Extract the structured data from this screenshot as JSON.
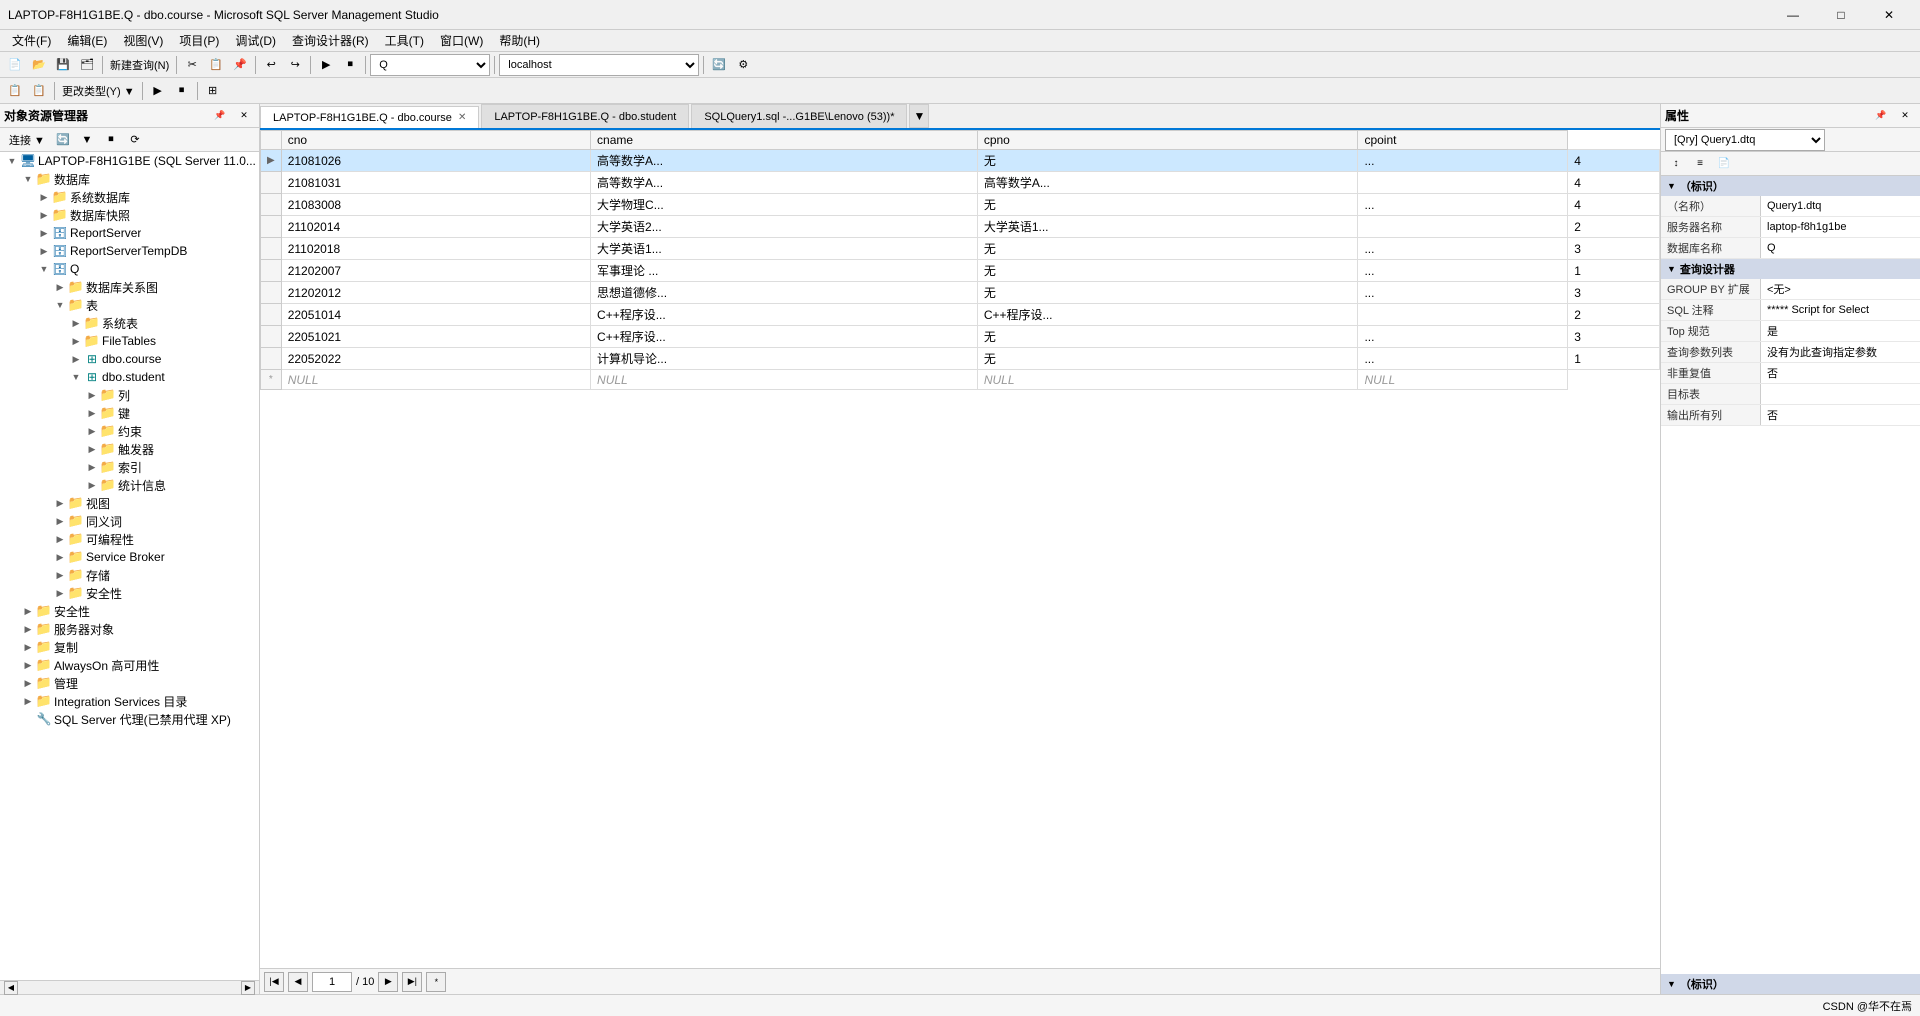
{
  "titlebar": {
    "title": "LAPTOP-F8H1G1BE.Q - dbo.course - Microsoft SQL Server Management Studio",
    "minimize": "—",
    "maximize": "□",
    "close": "✕"
  },
  "menubar": {
    "items": [
      "文件(F)",
      "编辑(E)",
      "视图(V)",
      "项目(P)",
      "调试(D)",
      "查询设计器(R)",
      "工具(T)",
      "窗口(W)",
      "帮助(H)"
    ]
  },
  "left_panel": {
    "title": "对象资源管理器",
    "connect_label": "连接 ▼",
    "tree": [
      {
        "id": "server",
        "level": 0,
        "label": "LAPTOP-F8H1G1BE (SQL Server 11.0...",
        "icon": "server",
        "expanded": true
      },
      {
        "id": "databases",
        "level": 1,
        "label": "数据库",
        "icon": "folder",
        "expanded": true
      },
      {
        "id": "sysdbs",
        "level": 2,
        "label": "系统数据库",
        "icon": "folder",
        "expanded": false
      },
      {
        "id": "dbsnapshots",
        "level": 2,
        "label": "数据库快照",
        "icon": "folder",
        "expanded": false
      },
      {
        "id": "reportserver",
        "level": 2,
        "label": "ReportServer",
        "icon": "db",
        "expanded": false
      },
      {
        "id": "reportservertempdb",
        "level": 2,
        "label": "ReportServerTempDB",
        "icon": "db",
        "expanded": false
      },
      {
        "id": "Q",
        "level": 2,
        "label": "Q",
        "icon": "db",
        "expanded": true
      },
      {
        "id": "dbdiagram",
        "level": 3,
        "label": "数据库关系图",
        "icon": "folder",
        "expanded": false
      },
      {
        "id": "tables",
        "level": 3,
        "label": "表",
        "icon": "folder",
        "expanded": true
      },
      {
        "id": "systables",
        "level": 4,
        "label": "系统表",
        "icon": "folder",
        "expanded": false
      },
      {
        "id": "filetables",
        "level": 4,
        "label": "FileTables",
        "icon": "folder",
        "expanded": false
      },
      {
        "id": "dbo_course",
        "level": 4,
        "label": "dbo.course",
        "icon": "table",
        "expanded": false
      },
      {
        "id": "dbo_student",
        "level": 4,
        "label": "dbo.student",
        "icon": "table",
        "expanded": true
      },
      {
        "id": "col",
        "level": 5,
        "label": "列",
        "icon": "folder",
        "expanded": false
      },
      {
        "id": "key",
        "level": 5,
        "label": "键",
        "icon": "folder",
        "expanded": false
      },
      {
        "id": "constraint",
        "level": 5,
        "label": "约束",
        "icon": "folder",
        "expanded": false
      },
      {
        "id": "trigger",
        "level": 5,
        "label": "触发器",
        "icon": "folder",
        "expanded": false
      },
      {
        "id": "index",
        "level": 5,
        "label": "索引",
        "icon": "folder",
        "expanded": false
      },
      {
        "id": "stats",
        "level": 5,
        "label": "统计信息",
        "icon": "folder",
        "expanded": false
      },
      {
        "id": "views",
        "level": 3,
        "label": "视图",
        "icon": "folder",
        "expanded": false
      },
      {
        "id": "synonyms",
        "level": 3,
        "label": "同义词",
        "icon": "folder",
        "expanded": false
      },
      {
        "id": "programmability",
        "level": 3,
        "label": "可编程性",
        "icon": "folder",
        "expanded": false
      },
      {
        "id": "servicebroker",
        "level": 3,
        "label": "Service Broker",
        "icon": "folder",
        "expanded": false
      },
      {
        "id": "storage",
        "level": 3,
        "label": "存储",
        "icon": "folder",
        "expanded": false
      },
      {
        "id": "security_q",
        "level": 3,
        "label": "安全性",
        "icon": "folder",
        "expanded": false
      },
      {
        "id": "security",
        "level": 1,
        "label": "安全性",
        "icon": "folder",
        "expanded": false
      },
      {
        "id": "serverobjects",
        "level": 1,
        "label": "服务器对象",
        "icon": "folder",
        "expanded": false
      },
      {
        "id": "replication",
        "level": 1,
        "label": "复制",
        "icon": "folder",
        "expanded": false
      },
      {
        "id": "alwayson",
        "level": 1,
        "label": "AlwaysOn 高可用性",
        "icon": "folder",
        "expanded": false
      },
      {
        "id": "management",
        "level": 1,
        "label": "管理",
        "icon": "folder",
        "expanded": false
      },
      {
        "id": "integration",
        "level": 1,
        "label": "Integration Services 目录",
        "icon": "folder",
        "expanded": false
      },
      {
        "id": "sqlagent",
        "level": 1,
        "label": "SQL Server 代理(已禁用代理 XP)",
        "icon": "agent",
        "expanded": false
      }
    ]
  },
  "tabs": [
    {
      "id": "course",
      "label": "LAPTOP-F8H1G1BE.Q - dbo.course",
      "active": true,
      "closeable": true
    },
    {
      "id": "student",
      "label": "LAPTOP-F8H1G1BE.Q - dbo.student",
      "active": false,
      "closeable": false
    },
    {
      "id": "sqlquery",
      "label": "SQLQuery1.sql -...G1BE\\Lenovo (53))*",
      "active": false,
      "closeable": false
    }
  ],
  "grid": {
    "columns": [
      "cno",
      "cname",
      "cpno",
      "cpoint"
    ],
    "rows": [
      {
        "marker": "▶",
        "selected": true,
        "cno": "21081026",
        "cname": "高等数学A...",
        "cpno": "无",
        "cpno2": "...",
        "cpoint": "4"
      },
      {
        "marker": "",
        "selected": false,
        "cno": "21081031",
        "cname": "高等数学A...",
        "cpno": "高等数学A...",
        "cpno2": "",
        "cpoint": "4"
      },
      {
        "marker": "",
        "selected": false,
        "cno": "21083008",
        "cname": "大学物理C...",
        "cpno": "无",
        "cpno2": "...",
        "cpoint": "4"
      },
      {
        "marker": "",
        "selected": false,
        "cno": "21102014",
        "cname": "大学英语2...",
        "cpno": "大学英语1...",
        "cpno2": "",
        "cpoint": "2"
      },
      {
        "marker": "",
        "selected": false,
        "cno": "21102018",
        "cname": "大学英语1...",
        "cpno": "无",
        "cpno2": "...",
        "cpoint": "3"
      },
      {
        "marker": "",
        "selected": false,
        "cno": "21202007",
        "cname": "军事理论 ...",
        "cpno": "无",
        "cpno2": "...",
        "cpoint": "1"
      },
      {
        "marker": "",
        "selected": false,
        "cno": "21202012",
        "cname": "思想道德修...",
        "cpno": "无",
        "cpno2": "...",
        "cpoint": "3"
      },
      {
        "marker": "",
        "selected": false,
        "cno": "22051014",
        "cname": "C++程序设...",
        "cpno": "C++程序设...",
        "cpno2": "",
        "cpoint": "2"
      },
      {
        "marker": "",
        "selected": false,
        "cno": "22051021",
        "cname": "C++程序设...",
        "cpno": "无",
        "cpno2": "...",
        "cpoint": "3"
      },
      {
        "marker": "",
        "selected": false,
        "cno": "22052022",
        "cname": "计算机导论...",
        "cpno": "无",
        "cpno2": "...",
        "cpoint": "1"
      }
    ],
    "new_row": {
      "cno": "NULL",
      "cname": "NULL",
      "cpno": "NULL",
      "cpoint": "NULL"
    },
    "pagination": {
      "current": "1",
      "total": "/ 10"
    }
  },
  "right_panel": {
    "title": "属性",
    "query_title": "[Qry] Query1.dtq",
    "sections": [
      {
        "name": "标识",
        "expanded": true,
        "properties": [
          {
            "name": "(名称)",
            "value": "Query1.dtq"
          },
          {
            "name": "服务器名称",
            "value": "laptop-f8h1g1be"
          },
          {
            "name": "数据库名称",
            "value": "Q"
          }
        ]
      },
      {
        "name": "查询设计器",
        "expanded": true,
        "properties": [
          {
            "name": "GROUP BY 扩展",
            "value": "<无>"
          },
          {
            "name": "SQL 注释",
            "value": "***** Script for Select"
          },
          {
            "name": "Top 规范",
            "value": "是"
          },
          {
            "name": "查询参数列表",
            "value": "没有为此查询指定参数"
          },
          {
            "name": "非重复值",
            "value": "否"
          },
          {
            "name": "目标表",
            "value": ""
          },
          {
            "name": "输出所有列",
            "value": "否"
          }
        ]
      },
      {
        "name": "标识",
        "expanded": false,
        "properties": []
      }
    ]
  },
  "statusbar": {
    "text": "CSDN @华不在焉"
  }
}
